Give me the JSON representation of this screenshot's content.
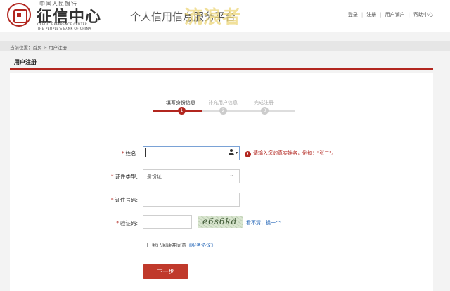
{
  "header": {
    "logo_top_text": "中国人民银行",
    "logo_cn": "征信中心",
    "logo_en_line1": "CREDIT REFERENCE CENTER",
    "logo_en_line2": "THE PEOPLE'S BANK OF CHINA",
    "site_title": "个人信用信息服务平台",
    "watermark": "流浪者",
    "nav": [
      {
        "label": "登录"
      },
      {
        "label": "注册"
      },
      {
        "label": "用户销户"
      },
      {
        "label": "帮助中心"
      }
    ]
  },
  "breadcrumb": "当前位置：首页 > 用户注册",
  "section_title": "用户注册",
  "steps": [
    {
      "label": "填写身份信息",
      "num": "1",
      "state": "active"
    },
    {
      "label": "补充用户信息",
      "num": "2",
      "state": "todo"
    },
    {
      "label": "完成注册",
      "num": "3",
      "state": "todo"
    }
  ],
  "form": {
    "name_label": "姓名:",
    "name_value": "",
    "name_hint": "请输入您的真实姓名，例如：\"张三\"。",
    "id_type_label": "证件类型:",
    "id_type_value": "身份证",
    "id_number_label": "证件号码:",
    "id_number_value": "",
    "captcha_label": "验证码:",
    "captcha_value": "",
    "captcha_text": "e6s6kd",
    "captcha_refresh": "看不清，换一个",
    "agree_prefix": "我已阅读并同意",
    "agree_link": "《服务协议》",
    "next_button": "下一步"
  },
  "colors": {
    "accent": "#b2261f",
    "link": "#1a5fb4",
    "button": "#c0392b"
  }
}
